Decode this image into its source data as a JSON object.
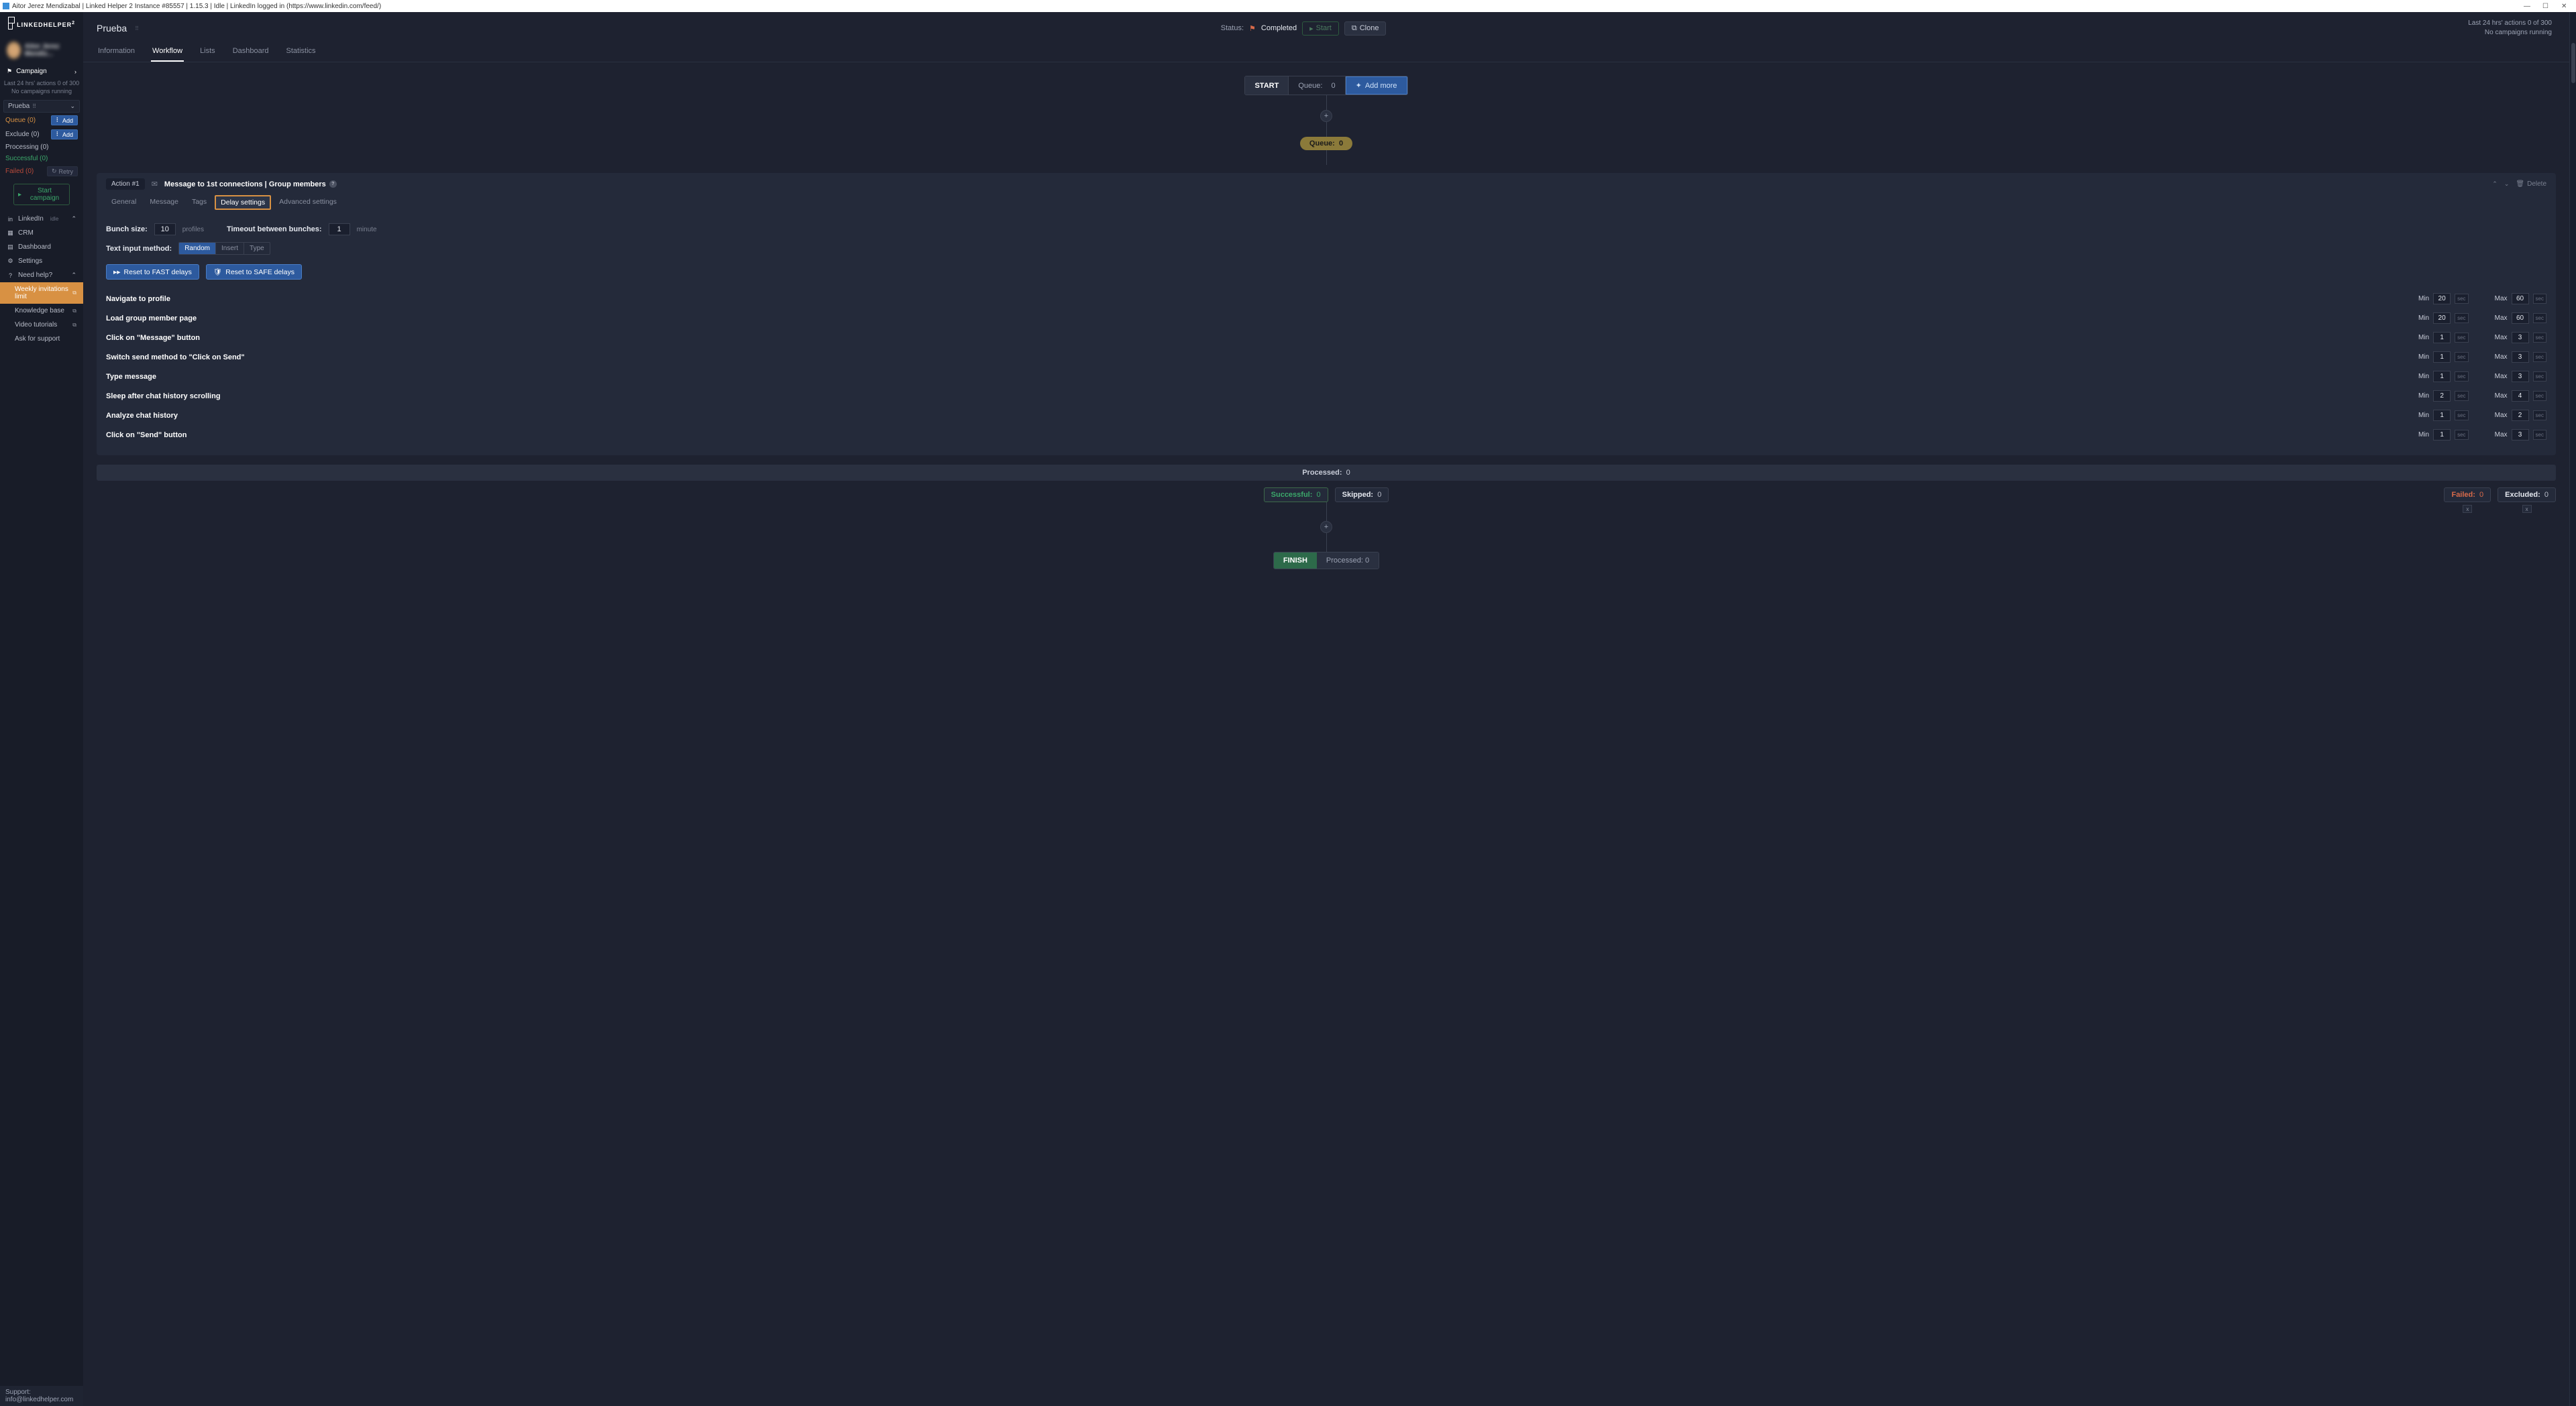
{
  "titlebar": "Aitor Jerez Mendizabal | Linked Helper 2 Instance #85557 | 1.15.3 | Idle | LinkedIn logged in (https://www.linkedin.com/feed/)",
  "logo": "LINKEDHELPER",
  "profile_name": "Aitor Jerez Mendiz...",
  "sidebar": {
    "campaign": "Campaign",
    "stats1": "Last 24 hrs' actions 0 of 300",
    "stats2": "No campaigns running",
    "dropdown": "Prueba",
    "queue": {
      "label": "Queue (0)",
      "add": "Add"
    },
    "exclude": {
      "label": "Exclude (0)",
      "add": "Add"
    },
    "processing": "Processing (0)",
    "successful": "Successful (0)",
    "failed": {
      "label": "Failed (0)",
      "retry": "Retry"
    },
    "start_campaign": "Start campaign",
    "linkedin": "LinkedIn",
    "idle": "idle",
    "crm": "CRM",
    "dashboard": "Dashboard",
    "settings": "Settings",
    "need_help": "Need help?",
    "weekly": "Weekly invitations limit",
    "knowledge": "Knowledge base",
    "video": "Video tutorials",
    "ask": "Ask for support"
  },
  "support": "Support: info@linkedhelper.com",
  "header": {
    "title": "Prueba",
    "status_label": "Status:",
    "status_value": "Completed",
    "start_btn": "Start",
    "clone_btn": "Clone",
    "stats1": "Last 24 hrs' actions 0 of 300",
    "stats2": "No campaigns running"
  },
  "tabs": [
    "Information",
    "Workflow",
    "Lists",
    "Dashboard",
    "Statistics"
  ],
  "workflow": {
    "start": "START",
    "queue_label": "Queue:",
    "queue_val": "0",
    "add_more": "Add more",
    "queue_pill_label": "Queue:",
    "queue_pill_val": "0",
    "action_num": "Action #1",
    "action_title": "Message to 1st connections | Group members",
    "delete": "Delete",
    "subtabs": [
      "General",
      "Message",
      "Tags",
      "Delay settings",
      "Advanced settings"
    ],
    "bunch_label": "Bunch size:",
    "bunch_val": "10",
    "bunch_unit": "profiles",
    "timeout_label": "Timeout between bunches:",
    "timeout_val": "1",
    "timeout_unit": "minute",
    "input_method_label": "Text input method:",
    "methods": [
      "Random",
      "Insert",
      "Type"
    ],
    "reset_fast": "Reset to FAST delays",
    "reset_safe": "Reset to SAFE delays",
    "delay_rows": [
      {
        "label": "Navigate to profile",
        "min": "20",
        "max": "60"
      },
      {
        "label": "Load group member page",
        "min": "20",
        "max": "60"
      },
      {
        "label": "Click on \"Message\" button",
        "min": "1",
        "max": "3"
      },
      {
        "label": "Switch send method to \"Click on Send\"",
        "min": "1",
        "max": "3"
      },
      {
        "label": "Type message",
        "min": "1",
        "max": "3"
      },
      {
        "label": "Sleep after chat history scrolling",
        "min": "2",
        "max": "4"
      },
      {
        "label": "Analyze chat history",
        "min": "1",
        "max": "2"
      },
      {
        "label": "Click on \"Send\" button",
        "min": "1",
        "max": "3"
      }
    ],
    "min_label": "Min",
    "max_label": "Max",
    "sec": "sec",
    "processed_label": "Processed:",
    "processed_val": "0",
    "successful_label": "Successful:",
    "successful_val": "0",
    "skipped_label": "Skipped:",
    "skipped_val": "0",
    "failed_label": "Failed:",
    "failed_val": "0",
    "excluded_label": "Excluded:",
    "excluded_val": "0",
    "finish": "FINISH",
    "finish_processed": "Processed: 0"
  }
}
